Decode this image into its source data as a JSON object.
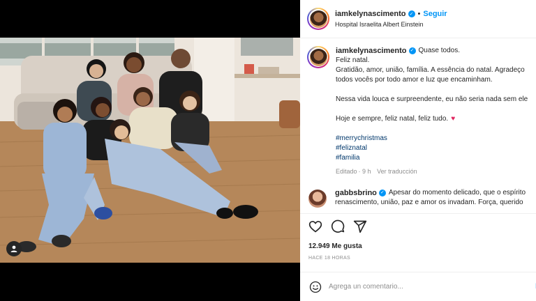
{
  "post": {
    "author": "iamkelynascimento",
    "follow_label": "Seguir",
    "separator": "•",
    "location": "Hospital Israelita Albert Einstein",
    "caption": {
      "title": "Quase todos.",
      "lines": [
        "Feliz natal.",
        "Gratidão, amor, união, família. A essência do natal. Agradeço",
        "todos vocês por todo amor e luz que encaminham."
      ],
      "line_b": "Nessa vida louca e surpreendente, eu não seria nada sem ele",
      "line_c": "Hoje e sempre, feliz natal, feliz tudo.",
      "hashtags": [
        "#merrychristmas",
        "#feliznatal",
        "#familia"
      ]
    },
    "edited_label": "Editado",
    "edited_time": "· 9 h",
    "translation_label": "Ver traducción"
  },
  "comment": {
    "author": "gabbsbrino",
    "line1": "Apesar do momento delicado, que o espírito",
    "line2": "renascimento, união, paz e amor os invadam. Força, querido"
  },
  "engagement": {
    "likes": "12.949 Me gusta",
    "time_ago": "HACE 18 HORAS"
  },
  "comment_box": {
    "placeholder": "Agrega un comentario...",
    "post_label": "P"
  },
  "colors": {
    "accent": "#0095f6",
    "heart": "#e0245e",
    "hashtag": "#00376b"
  },
  "icons": [
    "heart-icon",
    "comment-icon",
    "share-icon",
    "emoji-icon",
    "verified-icon",
    "user-tag-icon"
  ]
}
